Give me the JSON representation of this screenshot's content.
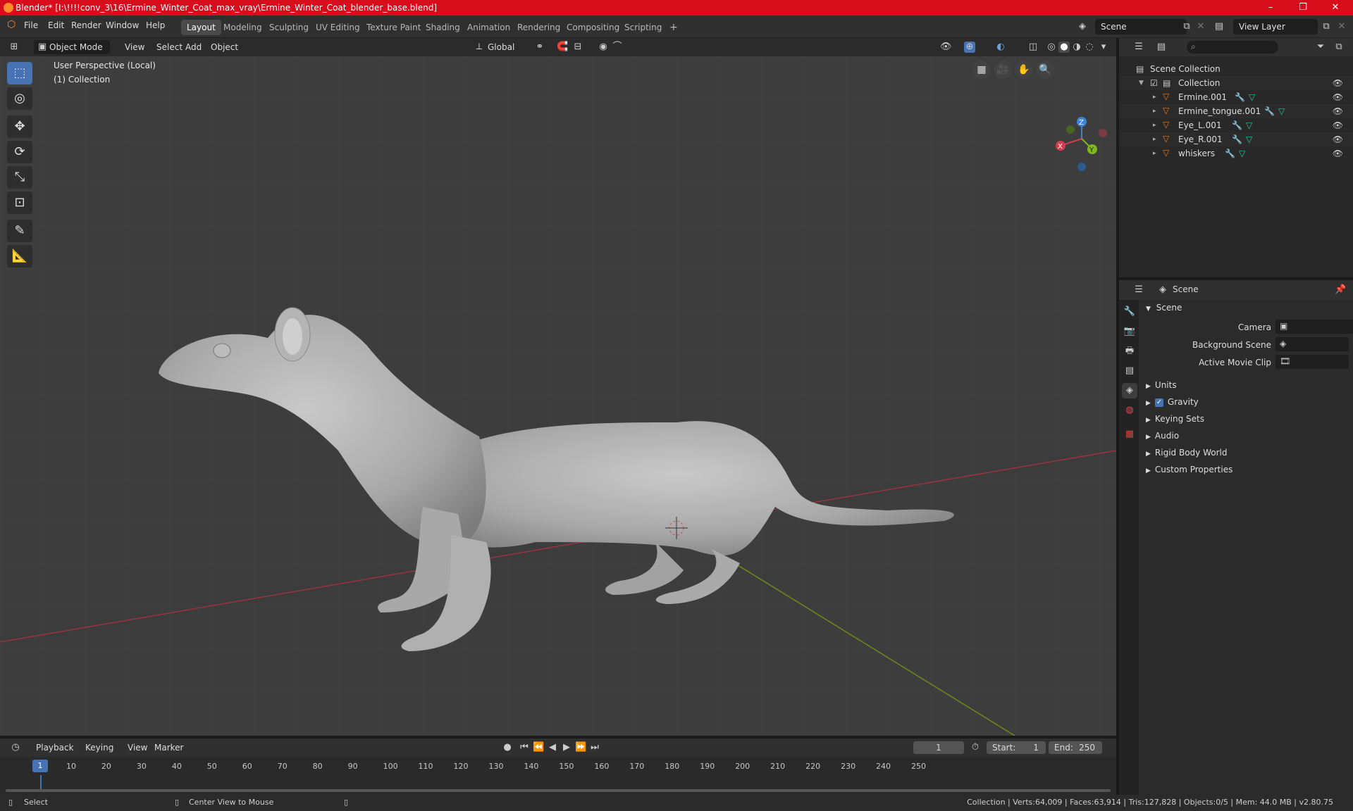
{
  "window": {
    "title": "Blender* [I:\\!!!!conv_3\\16\\Ermine_Winter_Coat_max_vray\\Ermine_Winter_Coat_blender_base.blend]",
    "controls": [
      "–",
      "❐",
      "✕"
    ]
  },
  "menubar": {
    "items": [
      "File",
      "Edit",
      "Render",
      "Window",
      "Help"
    ]
  },
  "workspaces": [
    "Layout",
    "Modeling",
    "Sculpting",
    "UV Editing",
    "Texture Paint",
    "Shading",
    "Animation",
    "Rendering",
    "Compositing",
    "Scripting",
    "+"
  ],
  "scene_field": "Scene",
  "view_layer_field": "View Layer",
  "viewport_header": {
    "mode": "Object Mode",
    "menus": [
      "View",
      "Select",
      "Add",
      "Object"
    ],
    "orientation": "Global"
  },
  "viewport": {
    "perspective": "User Perspective (Local)",
    "collection": "(1) Collection",
    "gizmo_axes": {
      "x": "X",
      "y": "Y",
      "z": "Z"
    }
  },
  "outliner": {
    "search_placeholder": "",
    "root": "Scene Collection",
    "collection": "Collection",
    "objects": [
      "Ermine.001",
      "Ermine_tongue.001",
      "Eye_L.001",
      "Eye_R.001",
      "whiskers"
    ]
  },
  "properties": {
    "context": "Scene",
    "section": "Scene",
    "fields": {
      "camera": "Camera",
      "background_scene": "Background Scene",
      "active_movie_clip": "Active Movie Clip"
    },
    "panels": [
      "Units",
      "Gravity",
      "Keying Sets",
      "Audio",
      "Rigid Body World",
      "Custom Properties"
    ],
    "gravity_checked": true
  },
  "timeline": {
    "menus": [
      "Playback",
      "Keying",
      "View",
      "Marker"
    ],
    "current_frame": "1",
    "start_label": "Start:",
    "start": "1",
    "end_label": "End:",
    "end": "250",
    "ticks": [
      "1",
      "10",
      "20",
      "30",
      "40",
      "50",
      "60",
      "70",
      "80",
      "90",
      "100",
      "110",
      "120",
      "130",
      "140",
      "150",
      "160",
      "170",
      "180",
      "190",
      "200",
      "210",
      "220",
      "230",
      "240",
      "250"
    ]
  },
  "statusbar": {
    "left": "Select",
    "middle": "Center View to Mouse",
    "stats": "Collection | Verts:64,009 | Faces:63,914 | Tris:127,828 | Objects:0/5 | Mem: 44.0 MB | v2.80.75"
  },
  "colors": {
    "accent": "#4772b3",
    "titlebar": "#d80d1c",
    "x_axis": "#d43c4f",
    "y_axis": "#7fb61b",
    "z_axis": "#3b84d8"
  }
}
